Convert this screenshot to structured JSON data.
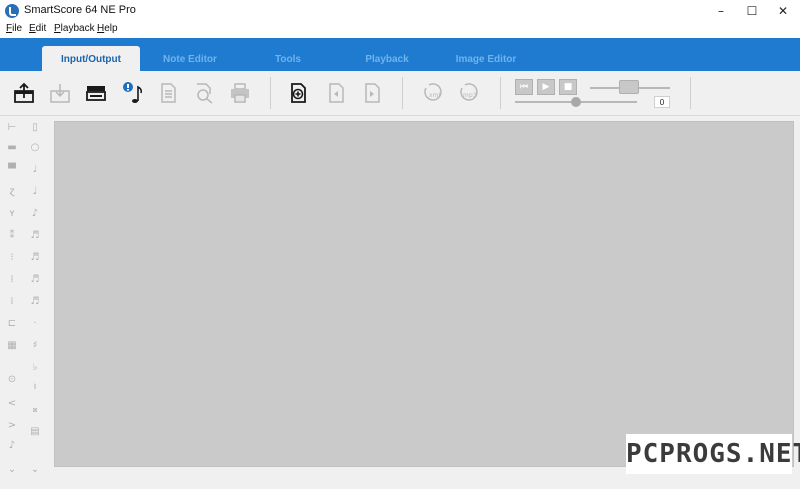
{
  "window": {
    "title": "SmartScore 64 NE Pro",
    "controls": {
      "minimize": "–",
      "maximize": "☐",
      "close": "✕"
    }
  },
  "menu": {
    "items": [
      "File",
      "Edit",
      "Playback",
      "Help"
    ]
  },
  "tabs": [
    {
      "label": "Input/Output",
      "active": true
    },
    {
      "label": "Note Editor",
      "active": false
    },
    {
      "label": "Tools",
      "active": false
    },
    {
      "label": "Playback",
      "active": false
    },
    {
      "label": "Image Editor",
      "active": false
    }
  ],
  "toolbar": {
    "buttons": [
      {
        "icon": "open-file-icon",
        "enabled": true
      },
      {
        "icon": "save-icon",
        "enabled": false
      },
      {
        "icon": "scan-icon",
        "enabled": true
      },
      {
        "icon": "info-note-icon",
        "enabled": true
      },
      {
        "icon": "document-icon",
        "enabled": false
      },
      {
        "icon": "zoom-search-icon",
        "enabled": false
      },
      {
        "icon": "print-icon",
        "enabled": false
      },
      {
        "icon": "add-page-icon",
        "enabled": true
      },
      {
        "icon": "previous-page-icon",
        "enabled": false
      },
      {
        "icon": "next-page-icon",
        "enabled": false
      },
      {
        "icon": "export-xml-icon",
        "enabled": false
      },
      {
        "icon": "export-mp3-icon",
        "enabled": false
      }
    ],
    "xml_label": "xml",
    "mp3_label": "mp3",
    "playback": {
      "rewind": "⏮",
      "play": "▶",
      "stop": "■",
      "tempo_value": "0"
    }
  },
  "watermark": "PCPROGS.NET",
  "colors": {
    "accent": "#1f7bd0",
    "tab_inactive_text": "#6fb4ee",
    "tab_active_text": "#1a64b0",
    "canvas": "#cacaca"
  }
}
